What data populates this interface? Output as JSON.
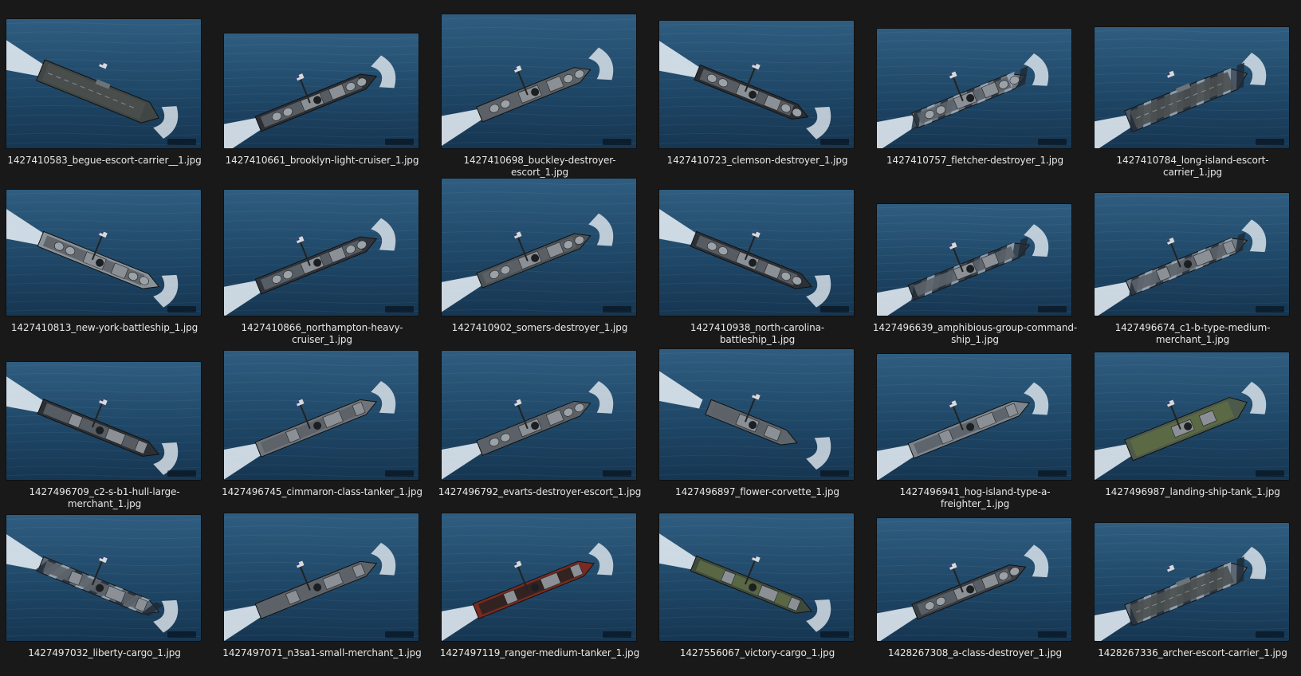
{
  "files": [
    {
      "name": "1427410583_begue-escort-carrier__1.jpg",
      "ship": "carrier",
      "camo": "gray",
      "hull": "#3f4644"
    },
    {
      "name": "1427410661_brooklyn-light-cruiser_1.jpg",
      "ship": "cruiser",
      "camo": "dark",
      "hull": "#2b2f36"
    },
    {
      "name": "1427410698_buckley-destroyer-escort_1.jpg",
      "ship": "destroyer",
      "camo": "gray",
      "hull": "#5b6166"
    },
    {
      "name": "1427410723_clemson-destroyer_1.jpg",
      "ship": "destroyer",
      "camo": "dark",
      "hull": "#2a2e33"
    },
    {
      "name": "1427410757_fletcher-destroyer_1.jpg",
      "ship": "destroyer",
      "camo": "dazzle",
      "hull": "#6d7a86"
    },
    {
      "name": "1427410784_long-island-escort-carrier_1.jpg",
      "ship": "carrier",
      "camo": "dazzle",
      "hull": "#4a5663"
    },
    {
      "name": "1427410813_new-york-battleship_1.jpg",
      "ship": "battleship",
      "camo": "gray",
      "hull": "#8a9299"
    },
    {
      "name": "1427410866_northampton-heavy-cruiser_1.jpg",
      "ship": "cruiser",
      "camo": "dark",
      "hull": "#30353d"
    },
    {
      "name": "1427410902_somers-destroyer_1.jpg",
      "ship": "destroyer",
      "camo": "gray",
      "hull": "#4b5258"
    },
    {
      "name": "1427410938_north-carolina-battleship_1.jpg",
      "ship": "battleship",
      "camo": "dark",
      "hull": "#2c3138"
    },
    {
      "name": "1427496639_amphibious-group-command-ship_1.jpg",
      "ship": "command",
      "camo": "dazzle",
      "hull": "#3a4652"
    },
    {
      "name": "1427496674_c1-b-type-medium-merchant_1.jpg",
      "ship": "merchant",
      "camo": "dazzle",
      "hull": "#6e7a84"
    },
    {
      "name": "1427496709_c2-s-b1-hull-large-merchant_1.jpg",
      "ship": "merchant",
      "camo": "dark",
      "hull": "#2b3036"
    },
    {
      "name": "1427496745_cimmaron-class-tanker_1.jpg",
      "ship": "tanker",
      "camo": "gray",
      "hull": "#6f747a"
    },
    {
      "name": "1427496792_evarts-destroyer-escort_1.jpg",
      "ship": "destroyer",
      "camo": "gray",
      "hull": "#5a6168"
    },
    {
      "name": "1427496897_flower-corvette_1.jpg",
      "ship": "corvette",
      "camo": "gray",
      "hull": "#5e656b"
    },
    {
      "name": "1427496941_hog-island-type-a-freighter_1.jpg",
      "ship": "merchant",
      "camo": "gray",
      "hull": "#7d868e"
    },
    {
      "name": "1427496987_landing-ship-tank_1.jpg",
      "ship": "lst",
      "camo": "olive",
      "hull": "#4e5a49"
    },
    {
      "name": "1427497032_liberty-cargo_1.jpg",
      "ship": "merchant",
      "camo": "dazzle",
      "hull": "#5a6774"
    },
    {
      "name": "1427497071_n3sa1-small-merchant_1.jpg",
      "ship": "merchant",
      "camo": "gray",
      "hull": "#5d6369"
    },
    {
      "name": "1427497119_ranger-medium-tanker_1.jpg",
      "ship": "tanker",
      "camo": "red",
      "hull": "#3a2826"
    },
    {
      "name": "1427556067_victory-cargo_1.jpg",
      "ship": "merchant",
      "camo": "olive",
      "hull": "#3e4a3c"
    },
    {
      "name": "1428267308_a-class-destroyer_1.jpg",
      "ship": "destroyer",
      "camo": "dark",
      "hull": "#3a3f46"
    },
    {
      "name": "1428267336_archer-escort-carrier_1.jpg",
      "ship": "carrier",
      "camo": "dazzle",
      "hull": "#5b6772"
    }
  ]
}
